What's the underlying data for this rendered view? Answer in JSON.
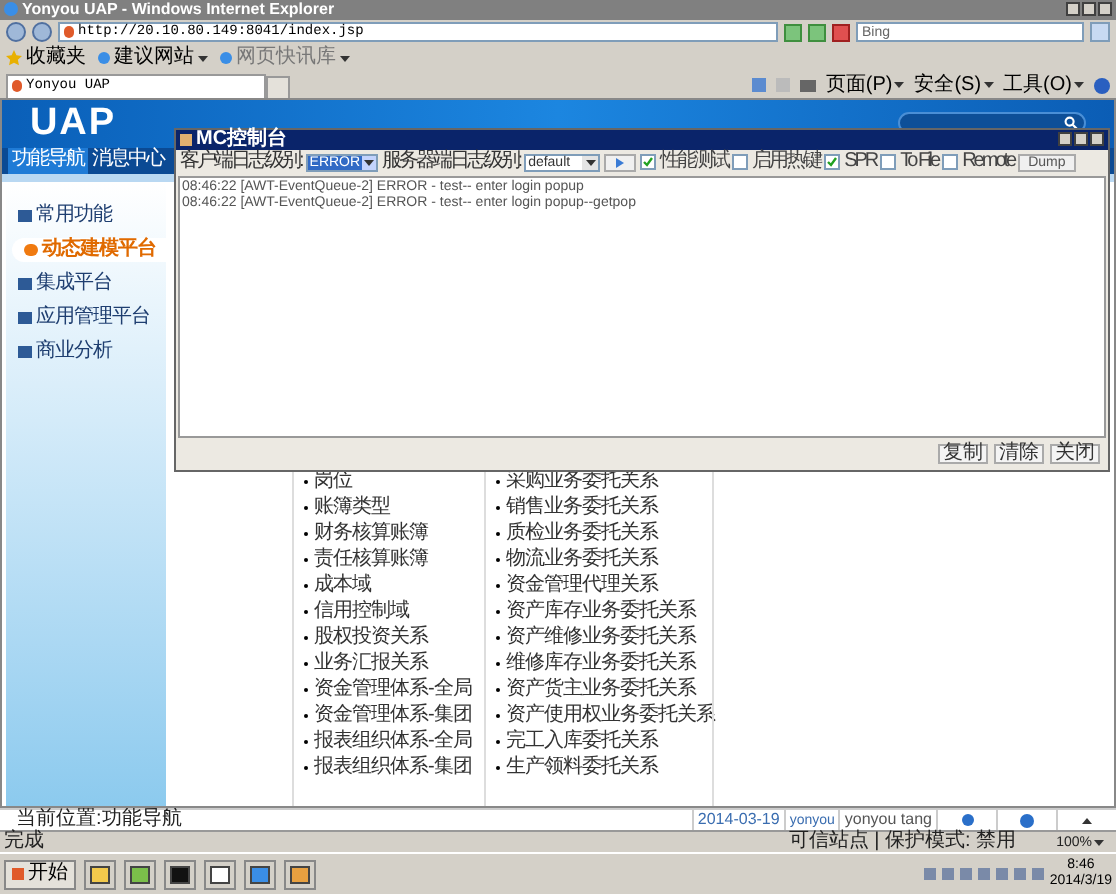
{
  "window": {
    "title": "Yonyou UAP - Windows Internet Explorer"
  },
  "address_bar": {
    "url": "http://20.10.80.149:8041/index.jsp"
  },
  "search": {
    "placeholder": "Bing"
  },
  "favorites_bar": {
    "title": "收藏夹",
    "links": [
      "建议网站",
      "网页快讯库"
    ]
  },
  "browser_tab": {
    "title": "Yonyou UAP"
  },
  "command_bar": [
    "页面(P)",
    "安全(S)",
    "工具(O)"
  ],
  "app": {
    "logo": "UAP",
    "tabs": [
      {
        "label": "功能导航",
        "selected": true
      },
      {
        "label": "消息中心",
        "selected": false
      }
    ]
  },
  "sidebar": {
    "items": [
      {
        "label": "常用功能",
        "selected": false
      },
      {
        "label": "动态建模平台",
        "selected": true
      },
      {
        "label": "集成平台",
        "selected": false
      },
      {
        "label": "应用管理平台",
        "selected": false
      },
      {
        "label": "商业分析",
        "selected": false
      }
    ]
  },
  "console": {
    "title": "MC控制台",
    "client_level_label": "客户端日志级别:",
    "client_level": "ERROR",
    "server_level_label": "服务器端日志级别:",
    "server_level": "default",
    "options": [
      {
        "label": "性能测试",
        "checked": true
      },
      {
        "label": "启用热键",
        "checked": false
      },
      {
        "label": "SPR",
        "checked": true
      },
      {
        "label": "To File",
        "checked": false
      },
      {
        "label": "Remote",
        "checked": false
      }
    ],
    "dump": "Dump",
    "log_lines": [
      "08:46:22 [AWT-EventQueue-2] ERROR - test-- enter login popup",
      "08:46:22 [AWT-EventQueue-2] ERROR - test-- enter login popup--getpop"
    ],
    "buttons": [
      "复制",
      "清除",
      "关闭"
    ]
  },
  "columns": [
    [
      "岗位",
      "账簿类型",
      "财务核算账簿",
      "责任核算账簿",
      "成本域",
      "信用控制域",
      "股权投资关系",
      "业务汇报关系",
      "资金管理体系-全局",
      "资金管理体系-集团",
      "报表组织体系-全局",
      "报表组织体系-集团"
    ],
    [
      "采购业务委托关系",
      "销售业务委托关系",
      "质检业务委托关系",
      "物流业务委托关系",
      "资金管理代理关系",
      "资产库存业务委托关系",
      "资产维修业务委托关系",
      "维修库存业务委托关系",
      "资产货主业务委托关系",
      "资产使用权业务委托关系",
      "完工入库委托关系",
      "生产领料委托关系"
    ]
  ],
  "status": {
    "location": "当前位置:功能导航",
    "date": "2014-03-19",
    "user_code": "yonyou",
    "user_name": "yonyou tang"
  },
  "ie_status": {
    "text": "完成",
    "zone": "可信站点 | 保护模式: 禁用",
    "zoom": "100%"
  },
  "taskbar": {
    "start": "开始",
    "time": "8:46",
    "date": "2014/3/19"
  }
}
